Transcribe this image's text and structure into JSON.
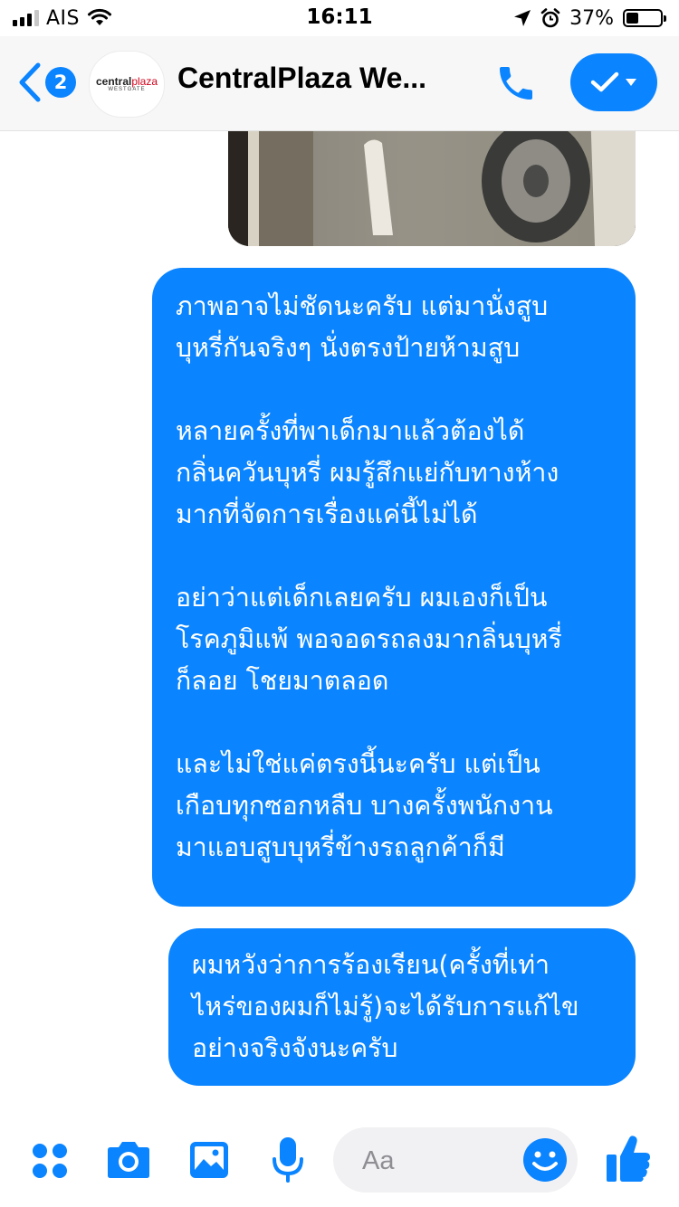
{
  "status_bar": {
    "carrier": "AIS",
    "time": "16:11",
    "battery_percent": "37%",
    "battery_level": 0.37,
    "signal_bars_active": 3,
    "icons": [
      "signal-icon",
      "wifi-icon",
      "location-arrow-icon",
      "alarm-icon",
      "battery-icon"
    ]
  },
  "header": {
    "back_badge_count": "2",
    "page_logo": {
      "line1": "central",
      "line1_accent": "plaza",
      "line2": "WESTGATE"
    },
    "title": "CentralPlaza We...",
    "icons": [
      "back-chevron-icon",
      "phone-icon",
      "checkmark-icon",
      "caret-down-icon"
    ]
  },
  "messages": [
    {
      "type": "photo",
      "sender": "me"
    },
    {
      "type": "text",
      "sender": "me",
      "text": "ภาพอาจไม่ชัดนะครับ แต่มานั่งสูบ\nบุหรี่กันจริงๆ นั่งตรงป้ายห้ามสูบ\n\nหลายครั้งที่พาเด็กมาแล้วต้องได้\nกลิ่นควันบุหรี่ ผมรู้สึกแย่กับทางห้าง\nมากที่จัดการเรื่องแค่นี้ไม่ได้\n\nอย่าว่าแต่เด็กเลยครับ ผมเองก็เป็น\nโรคภูมิแพ้ พอจอดรถลงมากลิ่นบุหรี่\nก็ลอย โชยมาตลอด\n\nและไม่ใช่แค่ตรงนี้นะครับ แต่เป็น\nเกือบทุกซอกหลืบ บางครั้งพนักงาน\nมาแอบสูบบุหรี่ข้างรถลูกค้าก็มี"
    },
    {
      "type": "text",
      "sender": "me",
      "text": "ผมหวังว่าการร้องเรียน(ครั้งที่เท่า\nไหร่ของผมก็ไม่รู้)จะได้รับการแก้ไข\nอย่างจริงจังนะครับ"
    }
  ],
  "composer": {
    "placeholder": "Aa",
    "value": "",
    "icons": [
      "apps-grid-icon",
      "camera-icon",
      "image-icon",
      "microphone-icon",
      "emoji-icon",
      "thumbs-up-icon"
    ]
  },
  "colors": {
    "accent": "#0a84ff",
    "bubble_text": "#ffffff",
    "header_bg": "#f7f7f7",
    "input_bg": "#f1f1f3"
  }
}
